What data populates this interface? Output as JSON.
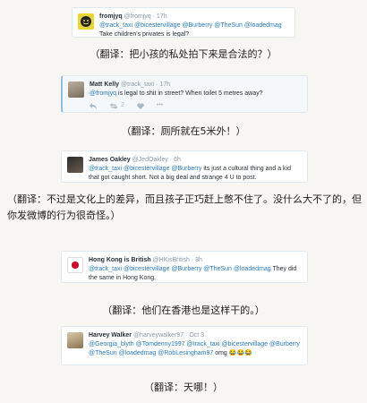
{
  "tweets": [
    {
      "name": "fromjyq",
      "handle": "@fromjyq",
      "time": "· 17h",
      "reply_prefix": "",
      "mentions": "@track_taxi @bicestervillage @Burberry @TheSun @loadedmag",
      "text": "Take children's privates is legal?",
      "retweets": "",
      "likes": ""
    },
    {
      "name": "Matt Kelly",
      "handle": "@track_taxi",
      "time": "· 17h",
      "mentions": "@fromjyq",
      "text": "is legal to shit in street? When toilet 5 metres away?",
      "retweets": "2",
      "likes": ""
    },
    {
      "name": "James Oakley",
      "handle": "@JedOakley",
      "time": "· 6h",
      "mentions": "@track_taxi @bicestervillage @Burberry",
      "text": "its just a cultural thing and a kid that got caught short. Not a big deal and strange 4 U to post.",
      "retweets": "",
      "likes": ""
    },
    {
      "name": "Hong Kong is British",
      "handle": "@HKisBritish",
      "time": "· 3h",
      "mentions": "@track_taxi @bicestervillage @Burberry @TheSun @loadedmag",
      "text": "They did the same in Hong Kong.",
      "retweets": "",
      "likes": ""
    },
    {
      "name": "Harvey Walker",
      "handle": "@harveywalker97",
      "time": "· Oct 3",
      "mentions": "@Georgia_blyth @Tomdenny1997 @track_taxi @bicestervillage @Burberry @TheSun @loadedmag @RobLesingham97",
      "text": "omg",
      "emoji": "😂😂😂",
      "retweets": "",
      "likes": ""
    }
  ],
  "captions": [
    "（翻译：把小孩的私处拍下来是合法的？）",
    "（翻译：厕所就在5米外！）",
    "（翻译：不过是文化上的差异，而且孩子正巧赶上憋不住了。没什么大不了的，但你发微博的行为很奇怪。）",
    "（翻译：他们在香港也是这样干的。）",
    "（翻译：天哪！）"
  ]
}
